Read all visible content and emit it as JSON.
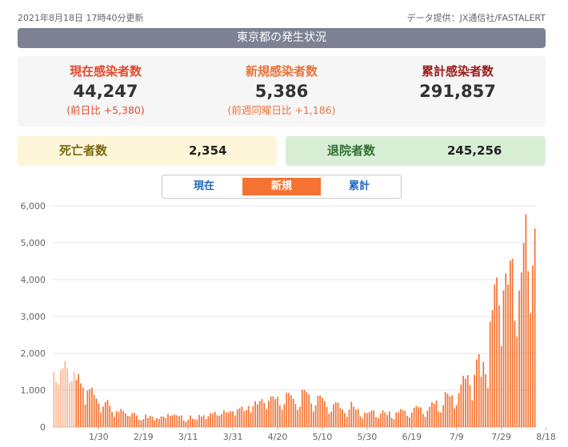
{
  "header": {
    "updated": "2021年8月18日 17時40分更新",
    "source": "データ提供：JX通信社/FASTALERT"
  },
  "title": "東京都の発生状況",
  "stats": {
    "current": {
      "label": "現在感染者数",
      "value": "44,247",
      "compare": "(前日比 +5,380)"
    },
    "new": {
      "label": "新規感染者数",
      "value": "5,386",
      "compare": "(前週同曜日比 +1,186)"
    },
    "total": {
      "label": "累計感染者数",
      "value": "291,857"
    }
  },
  "deaths": {
    "label": "死亡者数",
    "value": "2,354"
  },
  "recovered": {
    "label": "退院者数",
    "value": "245,256"
  },
  "tabs": [
    {
      "label": "現在",
      "active": false
    },
    {
      "label": "新規",
      "active": true
    },
    {
      "label": "累計",
      "active": false
    }
  ],
  "colors": {
    "bar": "#f47332",
    "bar_early": "#f5b899",
    "title_bg": "#7c8294",
    "grid": "#e6e6e6"
  },
  "chart_data": {
    "type": "bar",
    "ylim": [
      0,
      6000
    ],
    "yticks": [
      "0",
      "1,000",
      "2,000",
      "3,000",
      "4,000",
      "5,000",
      "6,000"
    ],
    "ytick_values": [
      0,
      1000,
      2000,
      3000,
      4000,
      5000,
      6000
    ],
    "xticks": [
      "1/30",
      "2/19",
      "3/11",
      "3/31",
      "4/20",
      "5/10",
      "5/30",
      "6/19",
      "7/9",
      "7/29",
      "8/18"
    ],
    "x_start": "2021-01-10",
    "x_end": "2021-08-18",
    "values": [
      1494,
      1219,
      1147,
      1536,
      1590,
      1791,
      1591,
      1204,
      1240,
      1502,
      1274,
      1433,
      1184,
      1070,
      618,
      986,
      1026,
      1064,
      868,
      769,
      633,
      393,
      556,
      676,
      734,
      577,
      412,
      276,
      429,
      412,
      491,
      434,
      371,
      307,
      289,
      377,
      378,
      316,
      203,
      178,
      213,
      336,
      241,
      301,
      281,
      179,
      240,
      220,
      287,
      279,
      245,
      349,
      299,
      318,
      340,
      317,
      293,
      316,
      174,
      143,
      205,
      316,
      227,
      210,
      201,
      325,
      280,
      320,
      218,
      293,
      376,
      364,
      413,
      317,
      304,
      350,
      452,
      395,
      401,
      425,
      425,
      313,
      475,
      510,
      553,
      428,
      459,
      569,
      391,
      556,
      701,
      615,
      704,
      756,
      650,
      485,
      711,
      829,
      829,
      756,
      822,
      591,
      469,
      621,
      925,
      922,
      864,
      762,
      625,
      465,
      544,
      1012,
      1004,
      948,
      884,
      639,
      425,
      586,
      843,
      856,
      790,
      703,
      541,
      356,
      416,
      615,
      673,
      655,
      514,
      477,
      377,
      274,
      469,
      684,
      551,
      471,
      486,
      288,
      229,
      395,
      377,
      404,
      443,
      451,
      265,
      245,
      360,
      450,
      394,
      325,
      425,
      250,
      210,
      390,
      404,
      486,
      464,
      439,
      304,
      257,
      391,
      519,
      571,
      537,
      534,
      356,
      269,
      445,
      545,
      670,
      634,
      719,
      419,
      397,
      594,
      950,
      905,
      831,
      860,
      502,
      593,
      920,
      1149,
      1387,
      1308,
      1410,
      1128,
      727,
      1410,
      1832,
      1979,
      1359,
      1763,
      1429,
      1057,
      2847,
      3177,
      3865,
      4058,
      3300,
      2195,
      3709,
      4166,
      3865,
      4515,
      4566,
      2884,
      2447,
      3709,
      4200,
      4989,
      5773,
      4226,
      3085,
      4377,
      5386
    ]
  }
}
